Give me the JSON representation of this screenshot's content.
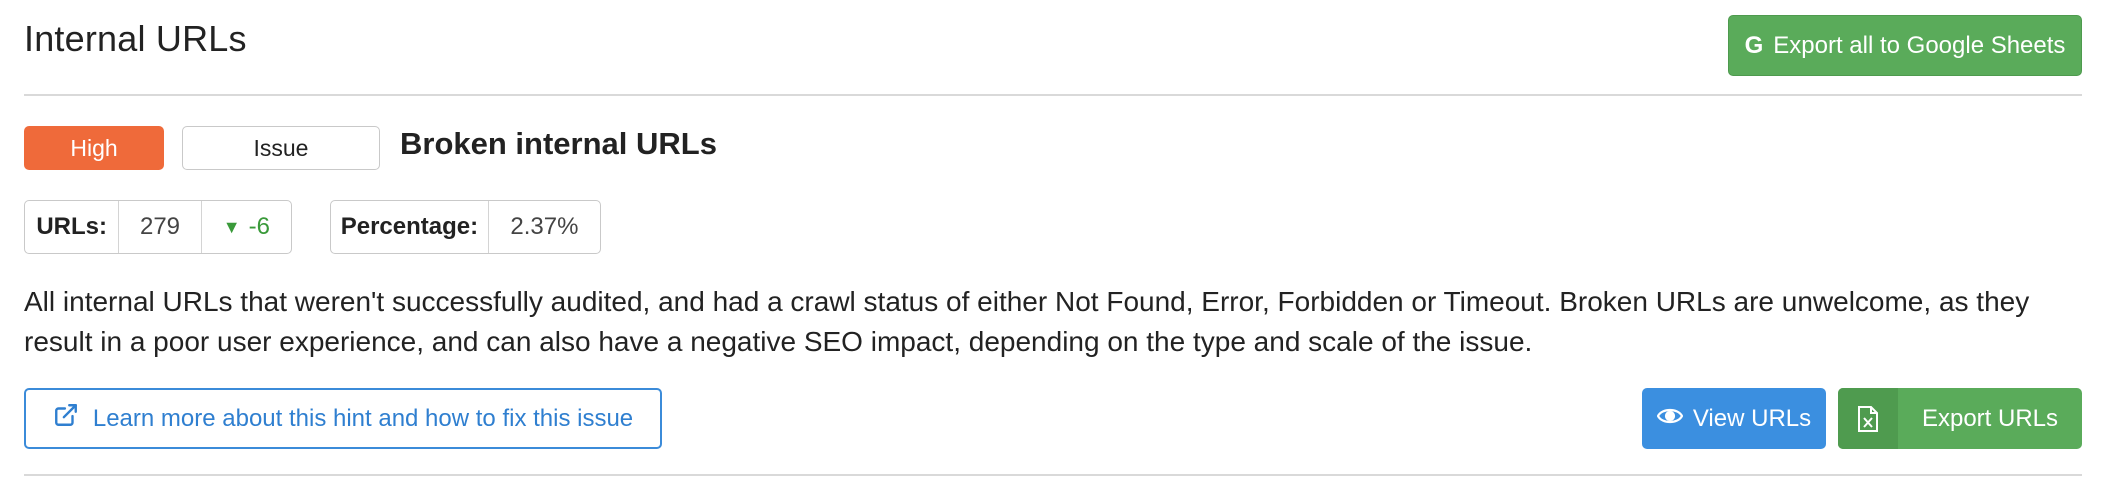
{
  "header": {
    "title": "Internal URLs",
    "export_sheets_label": "Export all to Google Sheets",
    "export_sheets_icon": "google-icon"
  },
  "hint": {
    "priority_label": "High",
    "type_label": "Issue",
    "title": "Broken internal URLs",
    "colors": {
      "high": "#ef6a3a",
      "success": "#5aab5a",
      "primary": "#3b8fe0"
    }
  },
  "stats": {
    "urls": {
      "label": "URLs:",
      "value": "279",
      "delta": "-6",
      "delta_icon": "triangle-down-icon"
    },
    "percentage": {
      "label": "Percentage:",
      "value": "2.37%"
    }
  },
  "description": "All internal URLs that weren't successfully audited, and had a crawl status of either Not Found, Error, Forbidden or Timeout. Broken URLs are unwelcome, as they result in a poor user experience, and can also have a negative SEO impact, depending on the type and scale of the issue.",
  "actions": {
    "learn_more_label": "Learn more about this hint and how to fix this issue",
    "learn_more_icon": "external-link-icon",
    "view_urls_label": "View URLs",
    "view_urls_icon": "eye-icon",
    "export_urls_label": "Export URLs",
    "export_urls_icon": "excel-icon"
  }
}
